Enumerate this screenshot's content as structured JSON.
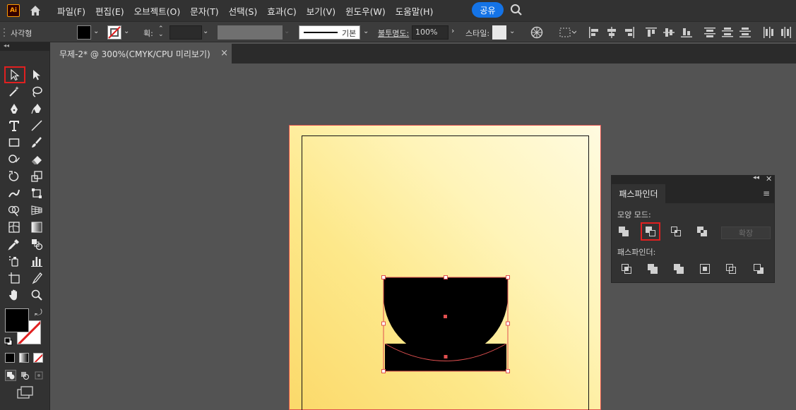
{
  "app": {
    "logo_text": "Ai"
  },
  "menu": [
    "파일(F)",
    "편집(E)",
    "오브젝트(O)",
    "문자(T)",
    "선택(S)",
    "효과(C)",
    "보기(V)",
    "윈도우(W)",
    "도움말(H)"
  ],
  "share_label": "공유",
  "control_bar": {
    "object_type": "사각형",
    "stroke_label": "획:",
    "stroke_style": "기본",
    "opacity_label": "불투명도:",
    "opacity_value": "100%",
    "style_label": "스타일:",
    "fill_color": "#000000"
  },
  "document_tab": {
    "title": "무제-2* @ 300%(CMYK/CPU 미리보기)",
    "close": "×"
  },
  "pathfinder": {
    "tab_label": "패스파인더",
    "shape_modes_label": "모양 모드:",
    "pathfinders_label": "패스파인더:",
    "expand_label": "확장",
    "shape_modes": [
      "unite-icon",
      "minus-front-icon",
      "intersect-icon",
      "exclude-icon"
    ],
    "pathfinders": [
      "divide-icon",
      "trim-icon",
      "merge-icon",
      "crop-icon",
      "outline-icon",
      "minus-back-icon"
    ]
  },
  "colors": {
    "accent": "#1473e6",
    "highlight_red": "#e02020",
    "selection": "#e05050"
  }
}
